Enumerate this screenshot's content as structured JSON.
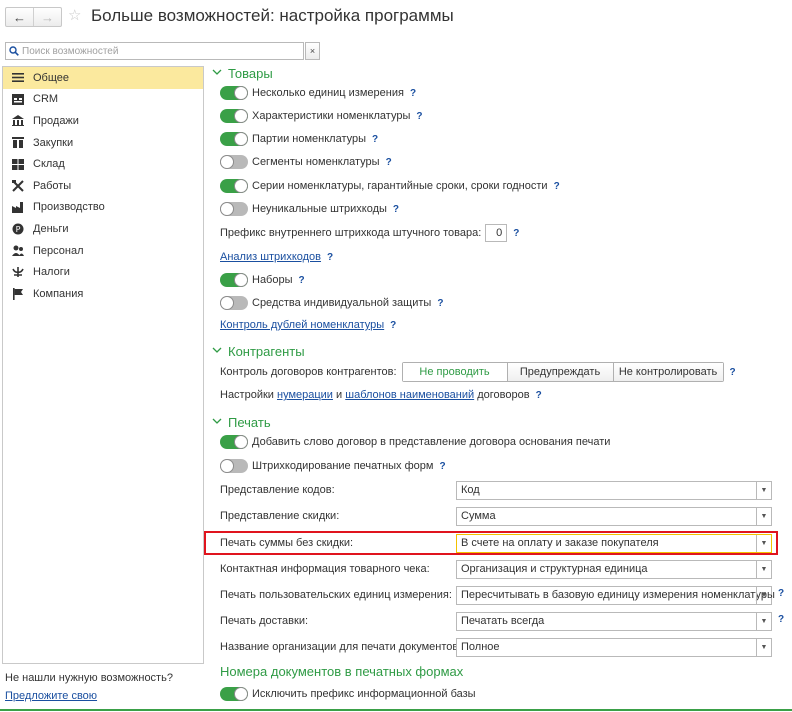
{
  "window": {
    "title": "Больше возможностей: настройка программы",
    "back_glyph": "←",
    "forward_glyph": "→",
    "star_glyph": "☆"
  },
  "search": {
    "placeholder": "Поиск возможностей",
    "clear_glyph": "×"
  },
  "sidebar": {
    "items": [
      {
        "label": "Общее",
        "icon": "list-icon",
        "active": true
      },
      {
        "label": "CRM",
        "icon": "crm-icon",
        "active": false
      },
      {
        "label": "Продажи",
        "icon": "sales-icon",
        "active": false
      },
      {
        "label": "Закупки",
        "icon": "purchases-icon",
        "active": false
      },
      {
        "label": "Склад",
        "icon": "warehouse-icon",
        "active": false
      },
      {
        "label": "Работы",
        "icon": "works-icon",
        "active": false
      },
      {
        "label": "Производство",
        "icon": "production-icon",
        "active": false
      },
      {
        "label": "Деньги",
        "icon": "money-icon",
        "active": false
      },
      {
        "label": "Персонал",
        "icon": "personnel-icon",
        "active": false
      },
      {
        "label": "Налоги",
        "icon": "taxes-icon",
        "active": false
      },
      {
        "label": "Компания",
        "icon": "company-icon",
        "active": false
      }
    ],
    "not_found": "Не нашли нужную возможность?",
    "suggest_link": "Предложите свою"
  },
  "goods": {
    "title": "Товары",
    "options": [
      {
        "label": "Несколько единиц измерения",
        "on": true,
        "help": "?"
      },
      {
        "label": "Характеристики номенклатуры",
        "on": true,
        "help": "?"
      },
      {
        "label": "Партии номенклатуры",
        "on": true,
        "help": "?"
      },
      {
        "label": "Сегменты номенклатуры",
        "on": false,
        "help": "?"
      },
      {
        "label": "Серии номенклатуры, гарантийные сроки, сроки годности",
        "on": true,
        "help": "?"
      },
      {
        "label": "Неуникальные штрихкоды",
        "on": false,
        "help": "?"
      }
    ],
    "prefix_label": "Префикс внутреннего штрихкода штучного товара:",
    "prefix_value": "0",
    "prefix_help": "?",
    "barcode_analysis_link": "Анализ штрихкодов",
    "barcode_analysis_help": "?",
    "sets_label": "Наборы",
    "sets_on": true,
    "sets_help": "?",
    "ppe_label": "Средства индивидуальной защиты",
    "ppe_on": false,
    "ppe_help": "?",
    "duplicates_link": "Контроль дублей номенклатуры",
    "duplicates_help": "?"
  },
  "contractors": {
    "title": "Контрагенты",
    "contract_control_label": "Контроль договоров контрагентов:",
    "contract_control_options": [
      "Не проводить",
      "Предупреждать",
      "Не контролировать"
    ],
    "contract_control_selected": "Не проводить",
    "contract_control_help": "?",
    "settings_prefix": "Настройки",
    "numbering_link": "нумерации",
    "and_text": "и",
    "name_templates_link": "шаблонов наименований",
    "contracts_text": "договоров",
    "settings_help": "?"
  },
  "printing": {
    "title": "Печать",
    "add_contract_word_label": "Добавить слово договор в представление договора основания печати",
    "add_contract_word_on": true,
    "barcoding_label": "Штрихкодирование печатных форм",
    "barcoding_on": false,
    "barcoding_help": "?",
    "fields": [
      {
        "label": "Представление кодов:",
        "value": "Код",
        "help": ""
      },
      {
        "label": "Представление скидки:",
        "value": "Сумма",
        "help": ""
      },
      {
        "label": "Печать суммы без скидки:",
        "value": "В счете на оплату и заказе покупателя",
        "help": ""
      },
      {
        "label": "Контактная информация товарного чека:",
        "value": "Организация и структурная единица",
        "help": ""
      },
      {
        "label": "Печать пользовательских единиц измерения:",
        "value": "Пересчитывать в базовую единицу измерения номенклатуры",
        "help": "?"
      },
      {
        "label": "Печать доставки:",
        "value": "Печатать всегда",
        "help": "?"
      },
      {
        "label": "Название организации для печати документов:",
        "value": "Полное",
        "help": ""
      }
    ]
  },
  "doc_numbers": {
    "title": "Номера документов в печатных формах",
    "exclude_prefix_label": "Исключить префикс информационной базы",
    "exclude_prefix_on": true
  },
  "colors": {
    "accent_green": "#2f9b45",
    "toggle_on": "#3aa047",
    "highlight_red": "#e0141e",
    "active_item": "#fbe99e",
    "link_blue": "#1a4fa0"
  }
}
